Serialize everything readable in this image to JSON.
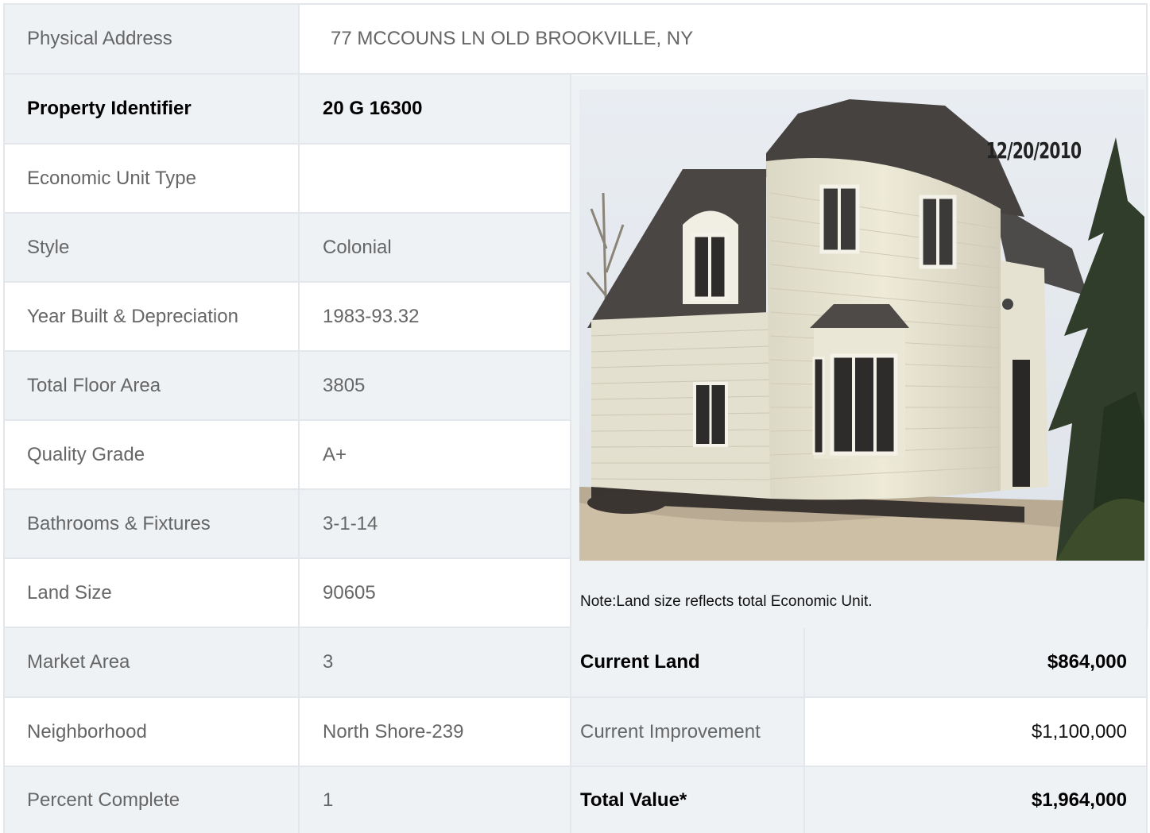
{
  "address": {
    "label": "Physical Address",
    "value": "77  MCCOUNS LN  OLD BROOKVILLE, NY"
  },
  "details": [
    {
      "label": "Property Identifier",
      "value": "20  G  16300"
    },
    {
      "label": "Economic Unit Type",
      "value": ""
    },
    {
      "label": "Style",
      "value": "Colonial"
    },
    {
      "label": "Year Built & Depreciation",
      "value": "1983-93.32"
    },
    {
      "label": "Total Floor Area",
      "value": "3805"
    },
    {
      "label": "Quality Grade",
      "value": "A+"
    },
    {
      "label": "Bathrooms & Fixtures",
      "value": "3-1-14"
    },
    {
      "label": "Land Size",
      "value": "90605"
    },
    {
      "label": "Market Area",
      "value": "3"
    },
    {
      "label": "Neighborhood",
      "value": "North Shore-239"
    },
    {
      "label": "Percent Complete",
      "value": "1"
    }
  ],
  "photo": {
    "date_stamp": "12/20/2010",
    "note": "Note:Land size reflects total Economic Unit."
  },
  "valuation": [
    {
      "label": "Current Land",
      "value": "$864,000"
    },
    {
      "label": "Current Improvement",
      "value": "$1,100,000"
    },
    {
      "label": "Total Value*",
      "value": "$1,964,000"
    }
  ],
  "colors": {
    "row_gray": "#eff2f5",
    "border": "#e3e7eb",
    "text": "#666666",
    "text_bold": "#000000"
  }
}
